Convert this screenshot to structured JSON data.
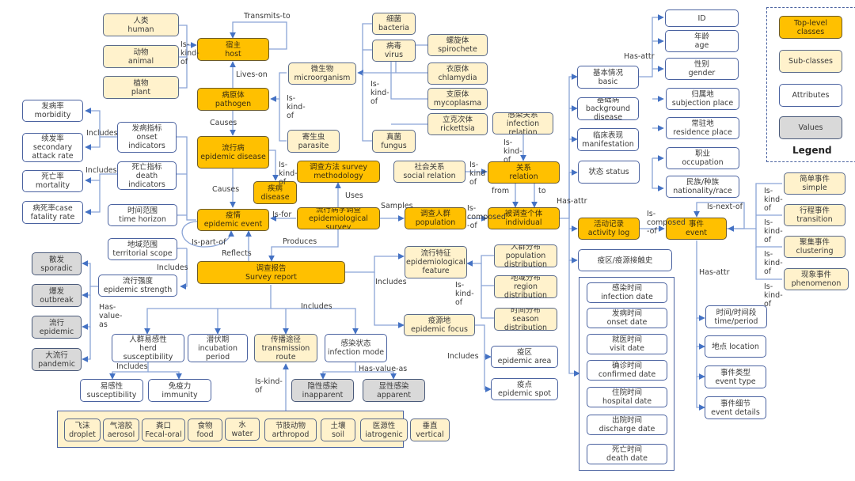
{
  "colors": {
    "top_level": "#ffc000",
    "sub_class": "#fff2cc",
    "attribute": "#ffffff",
    "value": "#d9d9d9",
    "edge": "#4472c4"
  },
  "nodes": {
    "human": {
      "zh": "人类",
      "en": "human"
    },
    "animal": {
      "zh": "动物",
      "en": "animal"
    },
    "plant": {
      "zh": "植物",
      "en": "plant"
    },
    "host": {
      "zh": "宿主",
      "en": "host"
    },
    "pathogen": {
      "zh": "病原体",
      "en": "pathogen"
    },
    "epidemic_disease": {
      "zh": "流行病",
      "en": "epidemic disease"
    },
    "disease": {
      "zh": "疾病",
      "en": "disease"
    },
    "epidemic_event": {
      "zh": "疫情",
      "en": "epidemic event"
    },
    "microorganism": {
      "zh": "微生物",
      "en": "microorganism"
    },
    "parasite": {
      "zh": "寄生虫",
      "en": "parasite"
    },
    "bacteria": {
      "zh": "细菌",
      "en": "bacteria"
    },
    "virus": {
      "zh": "病毒",
      "en": "virus"
    },
    "fungus": {
      "zh": "真菌",
      "en": "fungus"
    },
    "spirochete": {
      "zh": "螺旋体",
      "en": "spirochete"
    },
    "chlamydia": {
      "zh": "衣原体",
      "en": "chlamydia"
    },
    "mycoplasma": {
      "zh": "支原体",
      "en": "mycoplasma"
    },
    "rickettsia": {
      "zh": "立克次体",
      "en": "rickettsia"
    },
    "morbidity": {
      "zh": "发病率",
      "en": "morbidity"
    },
    "secondary_attack_rate": {
      "zh": "续发率",
      "en": "secondary attack rate"
    },
    "mortality": {
      "zh": "死亡率",
      "en": "mortality"
    },
    "case_fatality_rate": {
      "zh": "病死率case",
      "en": "fatality rate"
    },
    "onset_indicators": {
      "zh": "发病指标",
      "en": "onset indicators"
    },
    "death_indicators": {
      "zh": "死亡指标",
      "en": "death indicators"
    },
    "time_horizon": {
      "zh": "时间范围",
      "en": "time horizon"
    },
    "territorial_scope": {
      "zh": "地域范围",
      "en": "territorial scope"
    },
    "epidemic_strength": {
      "zh": "流行强度",
      "en": "epidemic strength"
    },
    "sporadic": {
      "zh": "散发",
      "en": "sporadic"
    },
    "outbreak": {
      "zh": "爆发",
      "en": "outbreak"
    },
    "epidemic": {
      "zh": "流行",
      "en": "epidemic"
    },
    "pandemic": {
      "zh": "大流行",
      "en": "pandemic"
    },
    "survey_methodology": {
      "zh": "调查方法 survey",
      "en": "methodology"
    },
    "epidemiological_survey": {
      "zh": "流行病学调查",
      "en": "epidemiological survey"
    },
    "population": {
      "zh": "调查人群",
      "en": "population"
    },
    "individual": {
      "zh": "被调查个体",
      "en": "individual"
    },
    "social_relation": {
      "zh": "社会关系",
      "en": "social relation"
    },
    "relation": {
      "zh": "关系",
      "en": "relation"
    },
    "infection_relation": {
      "zh": "感染关系",
      "en": "infection relation"
    },
    "survey_report": {
      "zh": "调查报告",
      "en": "Survey report"
    },
    "epidemiological_feature": {
      "zh": "流行特征",
      "en": "epidemiological feature"
    },
    "population_distribution": {
      "zh": "人群分布",
      "en": "population distribution"
    },
    "region_distribution": {
      "zh": "地域分布",
      "en": "region distribution"
    },
    "season_distribution": {
      "zh": "时间分布",
      "en": "season distribution"
    },
    "epidemic_focus": {
      "zh": "疫源地",
      "en": "epidemic focus"
    },
    "epidemic_area": {
      "zh": "疫区",
      "en": "epidemic area"
    },
    "epidemic_spot": {
      "zh": "疫点",
      "en": "epidemic spot"
    },
    "herd_susceptibility": {
      "zh": "人群易感性",
      "en": "herd susceptibility"
    },
    "incubation_period": {
      "zh": "潜伏期",
      "en": "incubation period"
    },
    "transmission_route": {
      "zh": "传播途径",
      "en": "transmission route"
    },
    "infection_mode": {
      "zh": "感染状态",
      "en": "infection mode"
    },
    "susceptibility": {
      "zh": "易感性",
      "en": "susceptibility"
    },
    "immunity": {
      "zh": "免疫力",
      "en": "immunity"
    },
    "inapparent": {
      "zh": "隐性感染",
      "en": "inapparent"
    },
    "apparent": {
      "zh": "显性感染",
      "en": "apparent"
    },
    "basic": {
      "zh": "基本情况",
      "en": "basic"
    },
    "background_disease": {
      "zh": "基础病",
      "en": "background disease"
    },
    "manifestation": {
      "zh": "临床表现",
      "en": "manifestation"
    },
    "status": {
      "zh": "状态 status",
      "en": ""
    },
    "activity_log": {
      "zh": "活动记录",
      "en": "activity log"
    },
    "contact_history": {
      "zh": "疫区/疫源接触史",
      "en": ""
    },
    "id": {
      "zh": "ID",
      "en": ""
    },
    "age": {
      "zh": "年龄",
      "en": "age"
    },
    "gender": {
      "zh": "性别",
      "en": "gender"
    },
    "subjection_place": {
      "zh": "归属地",
      "en": "subjection place"
    },
    "residence_place": {
      "zh": "常驻地",
      "en": "residence place"
    },
    "occupation": {
      "zh": "职业",
      "en": "occupation"
    },
    "nationality": {
      "zh": "民族/种族",
      "en": "nationality/race"
    },
    "event": {
      "zh": "事件",
      "en": "event"
    },
    "simple": {
      "zh": "简单事件",
      "en": "simple"
    },
    "transition": {
      "zh": "行程事件",
      "en": "transition"
    },
    "clustering": {
      "zh": "聚集事件",
      "en": "clustering"
    },
    "phenomenon": {
      "zh": "现象事件",
      "en": "phenomenon"
    },
    "time_period": {
      "zh": "时间/时间段",
      "en": "time/period"
    },
    "location": {
      "zh": "地点 location",
      "en": ""
    },
    "event_type": {
      "zh": "事件类型",
      "en": "event type"
    },
    "event_details": {
      "zh": "事件细节",
      "en": "event details"
    },
    "infection_date": {
      "zh": "感染时间",
      "en": "infection date"
    },
    "onset_date": {
      "zh": "发病时间",
      "en": "onset date"
    },
    "visit_date": {
      "zh": "就医时间",
      "en": "visit date"
    },
    "confirmed_date": {
      "zh": "确诊时间",
      "en": "confirmed date"
    },
    "hospital_date": {
      "zh": "住院时间",
      "en": "hospital date"
    },
    "discharge_date": {
      "zh": "出院时间",
      "en": "discharge date"
    },
    "death_date": {
      "zh": "死亡时间",
      "en": "death date"
    },
    "droplet": {
      "zh": "飞沫",
      "en": "droplet"
    },
    "aerosol": {
      "zh": "气溶胶",
      "en": "aerosol"
    },
    "fecal_oral": {
      "zh": "粪口",
      "en": "Fecal-oral"
    },
    "food": {
      "zh": "食物",
      "en": "food"
    },
    "water": {
      "zh": "水",
      "en": "water"
    },
    "arthropod": {
      "zh": "节肢动物",
      "en": "arthropod"
    },
    "soil": {
      "zh": "土壤",
      "en": "soil"
    },
    "iatrogenic": {
      "zh": "医源性",
      "en": "iatrogenic"
    },
    "vertical": {
      "zh": "垂直",
      "en": "vertical"
    }
  },
  "edge_labels": {
    "transmits_to": "Transmits-to",
    "is_kind_of_host": "Is-\nkind-\nof",
    "lives_on": "Lives-on",
    "is_kind_of_pathogen": "Is-\nkind-\nof",
    "is_kind_of_micro": "Is-\nkind-\nof",
    "causes_1": "Causes",
    "causes_2": "Causes",
    "is_kind_of_disease": "Is-\nkind-\nof",
    "includes_onset": "Includes",
    "includes_death": "Includes",
    "includes_event": "Includes",
    "is_for": "Is-for",
    "uses": "Uses",
    "samples": "Samples",
    "is_composed_of_pop": "Is-\ncomposed\n-of",
    "is_kind_of_relation": "Is-\nkind\nof",
    "is_kind_of_infection": "Is-\nkind-\nof",
    "from": "from",
    "to": "to",
    "has_attr_individual": "Has-attr",
    "has_attr_basic": "Has-attr",
    "is_part_of": "Is-part-of",
    "reflects": "Reflects",
    "produces": "Produces",
    "has_value_as_strength": "Has-\nvalue-\nas",
    "includes_report": "Includes",
    "includes_feature": "Includes",
    "is_kind_of_feature": "Is-\nkind-\nof",
    "includes_focus": "Includes",
    "includes_herd": "Includes",
    "is_kind_of_route": "Is-kind-\nof",
    "has_value_as_mode": "Has-value-as",
    "is_composed_of_log": "Is-\ncomposed\n-of",
    "is_next_of": "Is-next-of",
    "has_attr_event": "Has-attr",
    "is_kind_of_ev1": "Is-\nkind-\nof",
    "is_kind_of_ev2": "Is-\nkind-\nof",
    "is_kind_of_ev3": "Is-\nkind-\nof",
    "is_kind_of_ev4": "Is-\nkind-\nof"
  },
  "legend": {
    "title": "Legend",
    "items": [
      {
        "label": "Top-level classes",
        "kind": "top"
      },
      {
        "label": "Sub-classes",
        "kind": "sub"
      },
      {
        "label": "Attributes",
        "kind": "attr"
      },
      {
        "label": "Values",
        "kind": "val"
      }
    ]
  }
}
